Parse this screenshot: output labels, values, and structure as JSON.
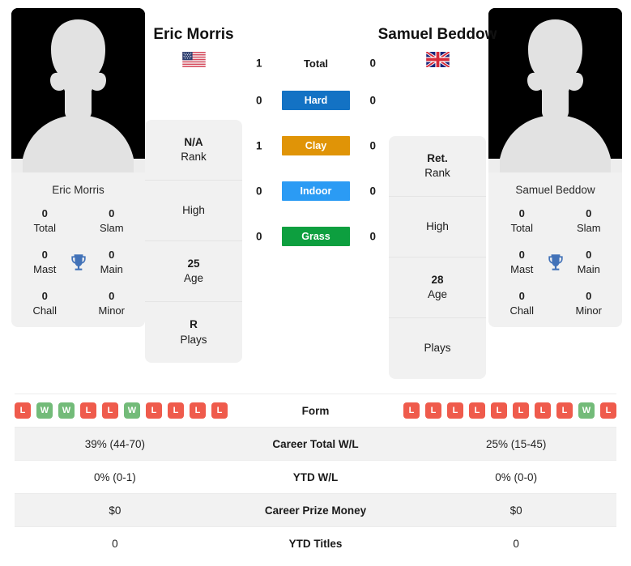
{
  "players": {
    "left": {
      "name": "Eric Morris",
      "flag": "us-flag-icon",
      "flag_alt": "United States",
      "card_name": "Eric Morris",
      "titles": [
        {
          "value": "0",
          "label": "Total"
        },
        {
          "value": "0",
          "label": "Slam"
        },
        {
          "value": "0",
          "label": "Mast"
        },
        {
          "value": "0",
          "label": "Main"
        },
        {
          "value": "0",
          "label": "Chall"
        },
        {
          "value": "0",
          "label": "Minor"
        }
      ],
      "info": [
        {
          "value": "N/A",
          "label": "Rank"
        },
        {
          "value": "",
          "label": "High"
        },
        {
          "value": "25",
          "label": "Age"
        },
        {
          "value": "R",
          "label": "Plays"
        }
      ],
      "form": [
        "L",
        "W",
        "W",
        "L",
        "L",
        "W",
        "L",
        "L",
        "L",
        "L"
      ],
      "career_total_wl": "39% (44-70)",
      "ytd_wl": "0% (0-1)",
      "career_prize_money": "$0",
      "ytd_titles": "0"
    },
    "right": {
      "name": "Samuel Beddow",
      "flag": "uk-flag-icon",
      "flag_alt": "United Kingdom",
      "card_name": "Samuel Beddow",
      "titles": [
        {
          "value": "0",
          "label": "Total"
        },
        {
          "value": "0",
          "label": "Slam"
        },
        {
          "value": "0",
          "label": "Mast"
        },
        {
          "value": "0",
          "label": "Main"
        },
        {
          "value": "0",
          "label": "Chall"
        },
        {
          "value": "0",
          "label": "Minor"
        }
      ],
      "info": [
        {
          "value": "Ret.",
          "label": "Rank"
        },
        {
          "value": "",
          "label": "High"
        },
        {
          "value": "28",
          "label": "Age"
        },
        {
          "value": "",
          "label": "Plays"
        }
      ],
      "form": [
        "L",
        "L",
        "L",
        "L",
        "L",
        "L",
        "L",
        "L",
        "W",
        "L"
      ],
      "career_total_wl": "25% (15-45)",
      "ytd_wl": "0% (0-0)",
      "career_prize_money": "$0",
      "ytd_titles": "0"
    }
  },
  "head_to_head": {
    "total": {
      "label": "Total",
      "left": "1",
      "right": "0"
    },
    "surfaces": [
      {
        "label": "Hard",
        "left": "0",
        "right": "0",
        "color": "#1372c4"
      },
      {
        "label": "Clay",
        "left": "1",
        "right": "0",
        "color": "#e09407"
      },
      {
        "label": "Indoor",
        "left": "0",
        "right": "0",
        "color": "#2b9bf4"
      },
      {
        "label": "Grass",
        "left": "0",
        "right": "0",
        "color": "#0d9f3f"
      }
    ]
  },
  "stat_table": {
    "rows": [
      {
        "label": "Form",
        "type": "form"
      },
      {
        "label": "Career Total W/L",
        "type": "text",
        "key": "career_total_wl"
      },
      {
        "label": "YTD W/L",
        "type": "text",
        "key": "ytd_wl"
      },
      {
        "label": "Career Prize Money",
        "type": "text",
        "key": "career_prize_money"
      },
      {
        "label": "YTD Titles",
        "type": "text",
        "key": "ytd_titles"
      }
    ]
  },
  "colors": {
    "win_badge": "#ef5b4c",
    "loss_badge": "#ef5b4c",
    "win_green": "#73bb79",
    "card_bg": "#f1f1f1",
    "stripe_bg": "#f2f2f2",
    "trophy": "#4272b8"
  }
}
